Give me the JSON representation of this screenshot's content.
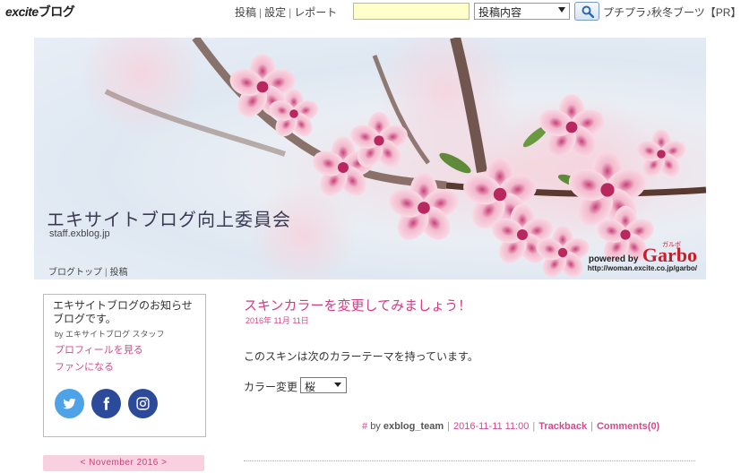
{
  "topbar": {
    "logo_text": "excite",
    "logo_suffix": "ブログ",
    "links": [
      "投稿",
      "設定",
      "レポート"
    ],
    "search_value": "",
    "search_scope": "投稿内容",
    "pr_text": "プチプラ♪秋冬ブーツ【PR】"
  },
  "header": {
    "title": "エキサイトブログ向上委員会",
    "url": "staff.exblog.jp",
    "nav": [
      "ブログトップ",
      "投稿"
    ],
    "powered_by": "powered by",
    "brand": "Garbo",
    "brand_kana": "ガルボ",
    "brand_url": "http://woman.excite.co.jp/garbo/"
  },
  "profile": {
    "description": "エキサイトブログのお知らせブログです。",
    "by": "by エキサイトブログ スタッフ",
    "profile_link": "プロフィールを見る",
    "fan_link": "ファンになる"
  },
  "social": [
    "twitter-icon",
    "facebook-icon",
    "instagram-icon"
  ],
  "calendar": {
    "label": "< November 2016 >"
  },
  "post": {
    "title": "スキンカラーを変更してみましょう！",
    "date": "2016年 11月 11日",
    "body": "このスキンは次のカラーテーマを持っています。",
    "color_label": "カラー変更",
    "color_value": "桜",
    "footer": {
      "hash": "#",
      "by": "by",
      "author": "exblog_team",
      "datetime": "2016-11-11 11:00",
      "trackback": "Trackback",
      "comments": "Comments(0)"
    }
  },
  "colors": {
    "accent_pink": "#d43a86",
    "calendar_bg": "#f8d0e0",
    "search_bg": "#ffffcc",
    "twitter": "#4ea2e8",
    "facebook": "#2c4a9a"
  }
}
